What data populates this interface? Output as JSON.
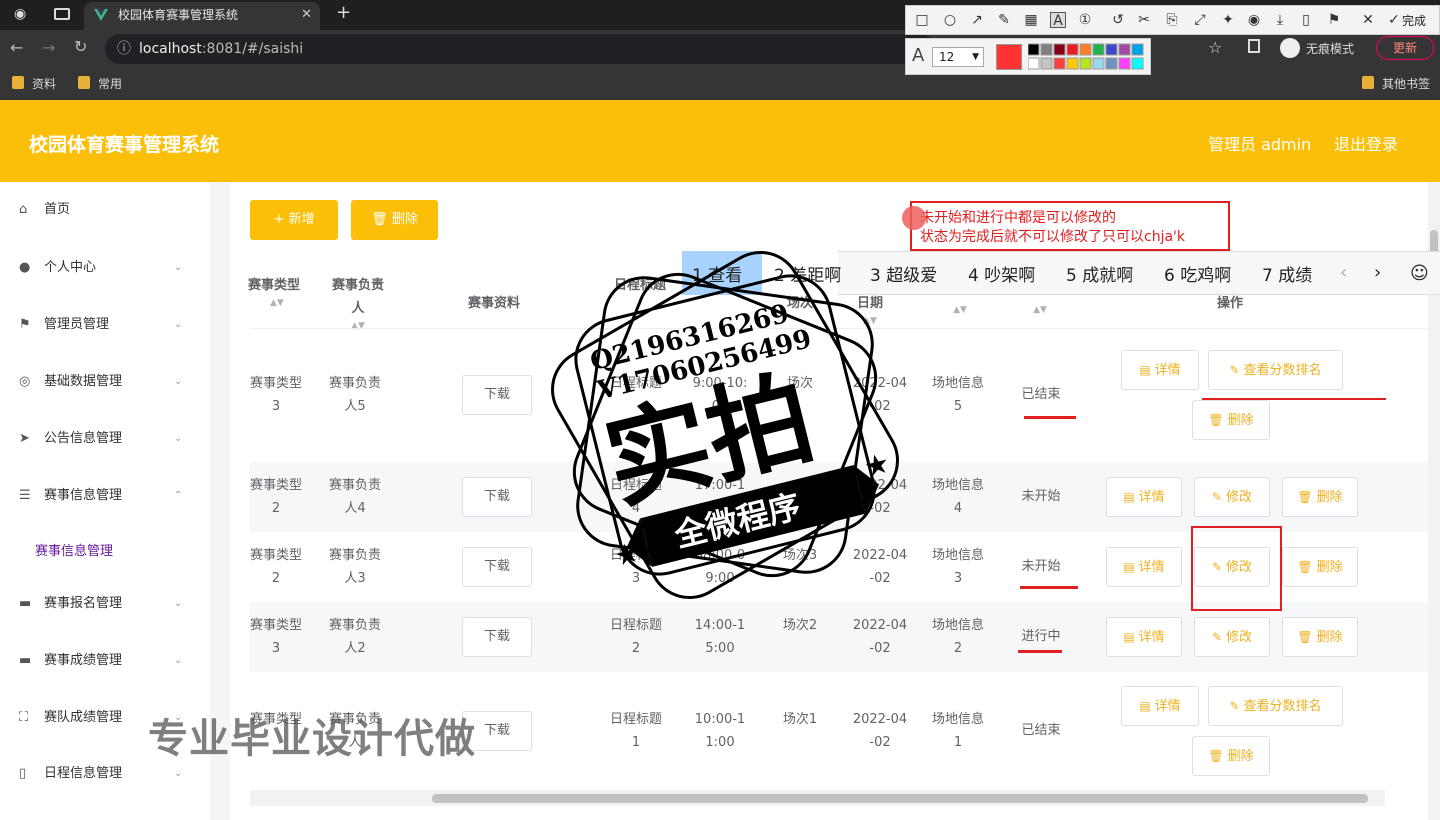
{
  "browser": {
    "tab_title": "校园体育赛事管理系统",
    "url_host": "localhost",
    "url_rest": ":8081/#/saishi",
    "bookmarks": [
      "资料",
      "常用"
    ],
    "bookmarks_right": "其他书签",
    "incognito_label": "无痕模式",
    "update_label": "更新",
    "done_label": "完成",
    "font_size_value": "12",
    "accent_color": "#fbbf08"
  },
  "header": {
    "title": "校园体育赛事管理系统",
    "admin_label": "管理员 admin",
    "logout_label": "退出登录"
  },
  "sidebar": {
    "items": [
      {
        "label": "首页"
      },
      {
        "label": "个人中心"
      },
      {
        "label": "管理员管理"
      },
      {
        "label": "基础数据管理"
      },
      {
        "label": "公告信息管理"
      },
      {
        "label": "赛事信息管理"
      },
      {
        "label": "赛事报名管理"
      },
      {
        "label": "赛事成绩管理"
      },
      {
        "label": "赛队成绩管理"
      },
      {
        "label": "日程信息管理"
      }
    ],
    "active_sub": "赛事信息管理"
  },
  "toolbar": {
    "add_label": "+ 新增",
    "delete_label": "删除"
  },
  "table": {
    "headers": {
      "type": "赛事类型",
      "owner": "赛事负责人",
      "material": "赛事资料",
      "schedule_title": "日程标题",
      "session": "场次",
      "date": "日期",
      "operation": "操作"
    },
    "rows": [
      {
        "type": "赛事类型3",
        "owner": "赛事负责人5",
        "download": "下载",
        "title": "日程标题",
        "time": "9:00-10:00",
        "session": "场次",
        "date": "2022-04-02",
        "venue": "场地信息5",
        "status": "已结束",
        "actions": [
          "详情",
          "查看分数排名",
          "删除"
        ]
      },
      {
        "type": "赛事类型2",
        "owner": "赛事负责人4",
        "download": "下载",
        "title": "日程标题4",
        "time": "17:00-1",
        "session": "",
        "date": "2022-04-02",
        "venue": "场地信息4",
        "status": "未开始",
        "actions": [
          "详情",
          "修改",
          "删除"
        ]
      },
      {
        "type": "赛事类型2",
        "owner": "赛事负责人3",
        "download": "下载",
        "title": "日程标题3",
        "time": "08:00-09:00",
        "session": "场次3",
        "date": "2022-04-02",
        "venue": "场地信息3",
        "status": "未开始",
        "actions": [
          "详情",
          "修改",
          "删除"
        ]
      },
      {
        "type": "赛事类型3",
        "owner": "赛事负责人2",
        "download": "下载",
        "title": "日程标题2",
        "time": "14:00-15:00",
        "session": "场次2",
        "date": "2022-04-02",
        "venue": "场地信息2",
        "status": "进行中",
        "actions": [
          "详情",
          "修改",
          "删除"
        ]
      },
      {
        "type": "赛事类型",
        "owner": "赛事负责人",
        "download": "下载",
        "title": "日程标题1",
        "time": "10:00-11:00",
        "session": "场次1",
        "date": "2022-04-02",
        "venue": "场地信息1",
        "status": "已结束",
        "actions": [
          "详情",
          "查看分数排名",
          "删除"
        ]
      }
    ]
  },
  "annotation": {
    "line1": "未开始和进行中都是可以修改的",
    "line2": "状态为完成后就不可以修改了只可以chja'k"
  },
  "ime_candidates": [
    "1 查看",
    "2 差距啊",
    "3 超级爱",
    "4 吵架啊",
    "5 成就啊",
    "6 吃鸡啊",
    "7 成绩"
  ],
  "watermark": {
    "qq": "Q2196316269",
    "vx": "V17060256499",
    "big": "实拍",
    "ribbon": "全微程序",
    "bottom": "专业毕业设计代做"
  }
}
